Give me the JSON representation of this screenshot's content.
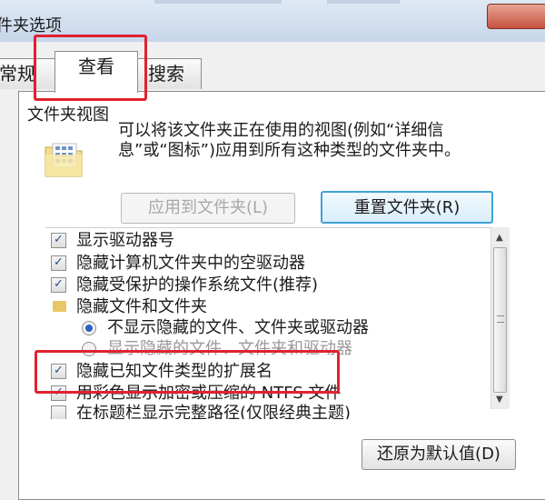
{
  "window": {
    "title": "件夹选项",
    "close_glyph": "✕"
  },
  "tabs": [
    {
      "label": "常规",
      "active": false
    },
    {
      "label": "查看",
      "active": true
    },
    {
      "label": "搜索",
      "active": false
    }
  ],
  "folder_views": {
    "label": "文件夹视图",
    "description": "可以将该文件夹正在使用的视图(例如“详细信息”或“图标”)应用到所有这种类型的文件夹中。",
    "apply_button": "应用到文件夹(L)",
    "reset_button": "重置文件夹(R)"
  },
  "advanced_settings": [
    {
      "type": "checkbox",
      "label": "显示驱动器号",
      "checked": true
    },
    {
      "type": "checkbox",
      "label": "隐藏计算机文件夹中的空驱动器",
      "checked": true
    },
    {
      "type": "checkbox",
      "label": "隐藏受保护的操作系统文件(推荐)",
      "checked": true
    },
    {
      "type": "folder",
      "label": "隐藏文件和文件夹"
    },
    {
      "type": "radio",
      "label": "不显示隐藏的文件、文件夹或驱动器",
      "selected": true
    },
    {
      "type": "radio",
      "label": "显示隐藏的文件、文件夹和驱动器",
      "selected": false
    },
    {
      "type": "checkbox",
      "label": "隐藏已知文件类型的扩展名",
      "checked": true
    },
    {
      "type": "checkbox",
      "label": "用彩色显示加密或压缩的 NTFS 文件",
      "checked": true
    },
    {
      "type": "checkbox",
      "label": "在标题栏显示完整路径(仅限经典主题)",
      "checked": false
    }
  ],
  "footer": {
    "restore_button": "还原为默认值(D)"
  },
  "icons": {
    "check": "✓",
    "scroll_up": "▲",
    "scroll_down": "▼"
  },
  "highlight_color": "#e0212f"
}
